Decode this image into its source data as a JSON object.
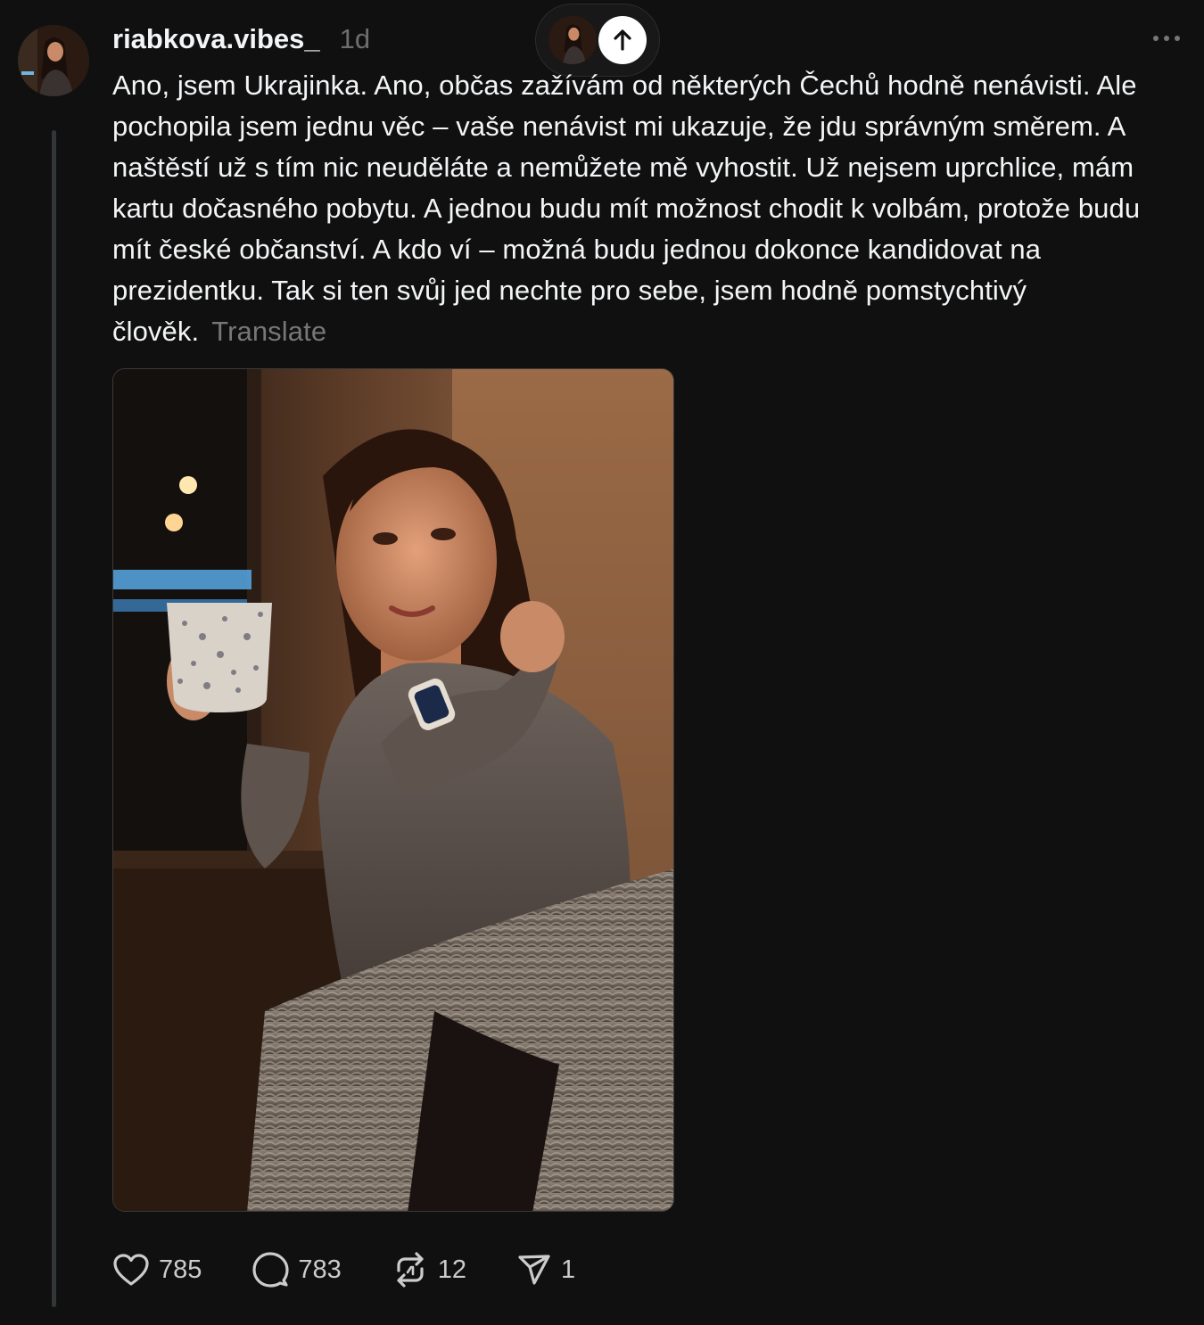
{
  "post": {
    "username": "riabkova.vibes_",
    "timestamp": "1d",
    "text": "Ano, jsem Ukrajinka. Ano, občas zažívám od některých Čechů hodně nenávisti. Ale pochopila jsem jednu věc – vaše nenávist mi ukazuje, že jdu správným směrem. A naštěstí už s tím nic neuděláte a nemůžete mě vyhostit. Už nejsem uprchlice, mám kartu dočasného pobytu. A jednou budu mít možnost chodit k volbám, protože budu mít české občanství. A kdo ví – možná budu jednou dokonce kandidovat na prezidentku. Tak si ten svůj jed nechte pro sebe, jsem hodně pomstychtivý člověk.",
    "translate_label": "Translate",
    "image_alt": "Photo of a woman holding a speckled ceramic mug in a warmly lit café"
  },
  "actions": {
    "likes": "785",
    "comments": "783",
    "reposts": "12",
    "shares": "1"
  },
  "icons": {
    "more": "more-horizontal-icon",
    "scroll_top": "arrow-up-icon",
    "like": "heart-icon",
    "comment": "comment-bubble-icon",
    "repost": "repost-icon",
    "share": "paper-plane-icon"
  },
  "colors": {
    "background": "#101010",
    "text": "#f3f5f7",
    "muted": "#777777",
    "thread_line": "#333638"
  }
}
